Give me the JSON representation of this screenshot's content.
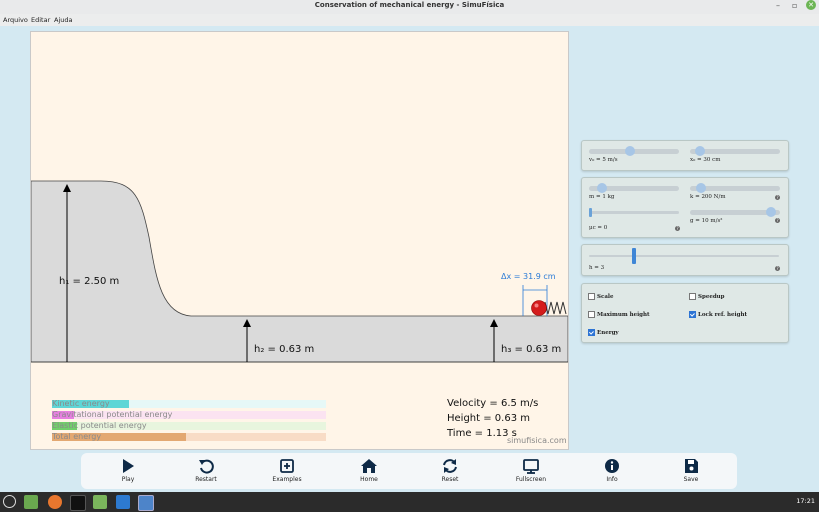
{
  "window": {
    "title": "Conservation of mechanical energy - SimuFísica"
  },
  "menu": [
    "Arquivo",
    "Editar",
    "Ajuda"
  ],
  "sim": {
    "h1": "h₁ = 2.50 m",
    "h2": "h₂ = 0.63 m",
    "h3": "h₃ = 0.63 m",
    "dx": "Δx = 31.9 cm",
    "brand": "simufisica.com"
  },
  "energy": [
    {
      "label": "Kinetic energy",
      "fraction": 0.28,
      "color": "#5ed6d6",
      "bg": "#e6f8f7"
    },
    {
      "label": "Gravitational potential energy",
      "fraction": 0.08,
      "color": "#e67fe0",
      "bg": "#fbe3f1"
    },
    {
      "label": "Elastic potential energy",
      "fraction": 0.09,
      "color": "#71cf6b",
      "bg": "#e8f5de"
    },
    {
      "label": "Total energy",
      "fraction": 0.49,
      "color": "#e3a872",
      "bg": "#f8dcc6"
    }
  ],
  "readouts": {
    "velocity": "Velocity = 6.5 m/s",
    "height": "Height = 0.63 m",
    "time": "Time = 1.13 s"
  },
  "controls": {
    "v0": {
      "label": "v₀ = 5 m/s",
      "fraction": 0.45
    },
    "x0": {
      "label": "x₀ = 30 cm",
      "fraction": 0.06
    },
    "m": {
      "label": "m = 1 kg",
      "fraction": 0.1
    },
    "k": {
      "label": "k = 200 N/m",
      "fraction": 0.08
    },
    "mu": {
      "label": "μc = 0",
      "fraction": 0.0
    },
    "g": {
      "label": "g = 10 m/s²",
      "fraction": 0.95
    },
    "h": {
      "label": "h = 3",
      "fraction": 0.23
    },
    "checks": [
      {
        "label": "Scale",
        "checked": false
      },
      {
        "label": "Speedup",
        "checked": false
      },
      {
        "label": "Maximum height",
        "checked": false
      },
      {
        "label": "Lock ref. height",
        "checked": true
      },
      {
        "label": "Energy",
        "checked": true
      }
    ]
  },
  "toolbar": [
    {
      "label": "Play",
      "icon": "play-icon"
    },
    {
      "label": "Restart",
      "icon": "restart-icon"
    },
    {
      "label": "Examples",
      "icon": "examples-icon"
    },
    {
      "label": "Home",
      "icon": "home-icon"
    },
    {
      "label": "Reset",
      "icon": "reset-icon"
    },
    {
      "label": "Fullscreen",
      "icon": "fullscreen-icon"
    },
    {
      "label": "Info",
      "icon": "info-icon"
    },
    {
      "label": "Save",
      "icon": "save-icon"
    }
  ],
  "taskbar": {
    "clock": "17:21"
  }
}
